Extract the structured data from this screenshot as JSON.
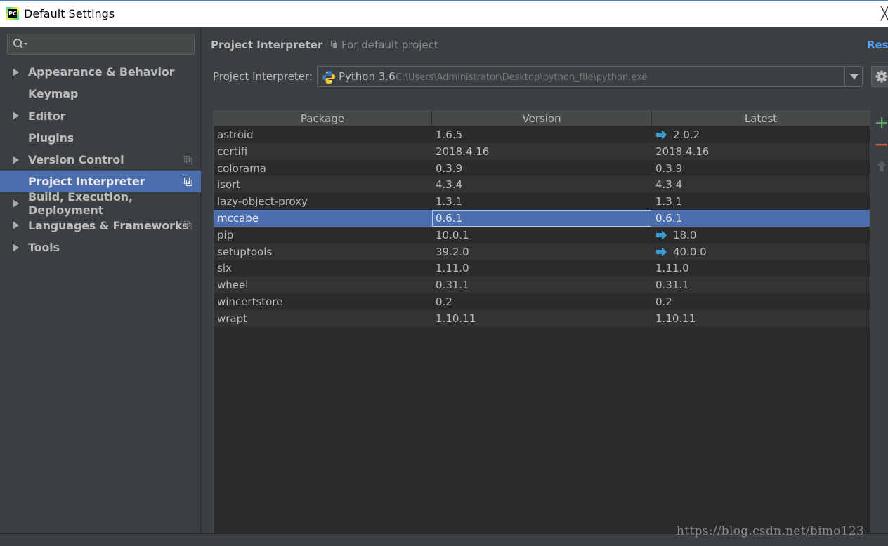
{
  "window": {
    "title": "Default Settings",
    "app_icon": "PC",
    "close_glyph": "╳"
  },
  "sidebar": {
    "search": {
      "placeholder": "",
      "icon": "search-icon"
    },
    "items": [
      {
        "label": "Appearance & Behavior",
        "expandable": true,
        "copy_icon": false,
        "selected": false
      },
      {
        "label": "Keymap",
        "expandable": false,
        "copy_icon": false,
        "selected": false
      },
      {
        "label": "Editor",
        "expandable": true,
        "copy_icon": false,
        "selected": false
      },
      {
        "label": "Plugins",
        "expandable": false,
        "copy_icon": false,
        "selected": false
      },
      {
        "label": "Version Control",
        "expandable": true,
        "copy_icon": true,
        "selected": false
      },
      {
        "label": "Project Interpreter",
        "expandable": false,
        "copy_icon": true,
        "selected": true
      },
      {
        "label": "Build, Execution, Deployment",
        "expandable": true,
        "copy_icon": false,
        "selected": false
      },
      {
        "label": "Languages & Frameworks",
        "expandable": true,
        "copy_icon": true,
        "selected": false
      },
      {
        "label": "Tools",
        "expandable": true,
        "copy_icon": false,
        "selected": false
      }
    ]
  },
  "main": {
    "title": "Project Interpreter",
    "scope_label": "For default project",
    "reset_label": "Reset",
    "interpreter": {
      "label": "Project Interpreter:",
      "name": "Python 3.6",
      "path": "C:\\Users\\Administrator\\Desktop\\python_file\\python.exe"
    }
  },
  "table": {
    "columns": [
      "Package",
      "Version",
      "Latest"
    ],
    "rows": [
      {
        "package": "astroid",
        "version": "1.6.5",
        "latest": "2.0.2",
        "upgrade": true
      },
      {
        "package": "certifi",
        "version": "2018.4.16",
        "latest": "2018.4.16",
        "upgrade": false
      },
      {
        "package": "colorama",
        "version": "0.3.9",
        "latest": "0.3.9",
        "upgrade": false
      },
      {
        "package": "isort",
        "version": "4.3.4",
        "latest": "4.3.4",
        "upgrade": false
      },
      {
        "package": "lazy-object-proxy",
        "version": "1.3.1",
        "latest": "1.3.1",
        "upgrade": false
      },
      {
        "package": "mccabe",
        "version": "0.6.1",
        "latest": "0.6.1",
        "upgrade": false,
        "selected": true
      },
      {
        "package": "pip",
        "version": "10.0.1",
        "latest": "18.0",
        "upgrade": true
      },
      {
        "package": "setuptools",
        "version": "39.2.0",
        "latest": "40.0.0",
        "upgrade": true
      },
      {
        "package": "six",
        "version": "1.11.0",
        "latest": "1.11.0",
        "upgrade": false
      },
      {
        "package": "wheel",
        "version": "0.31.1",
        "latest": "0.31.1",
        "upgrade": false
      },
      {
        "package": "wincertstore",
        "version": "0.2",
        "latest": "0.2",
        "upgrade": false
      },
      {
        "package": "wrapt",
        "version": "1.10.11",
        "latest": "1.10.11",
        "upgrade": false
      }
    ]
  },
  "toolbar": {
    "add_icon": "plus-icon",
    "remove_icon": "minus-icon",
    "upgrade_icon": "up-arrow-icon"
  },
  "watermark": "https://blog.csdn.net/bimo123",
  "colors": {
    "background": "#3c3f41",
    "selection": "#4b6eaf",
    "link": "#589df6",
    "upgrade_arrow": "#3e9fd8",
    "add_green": "#59a869",
    "remove_red": "#e05e3a"
  }
}
